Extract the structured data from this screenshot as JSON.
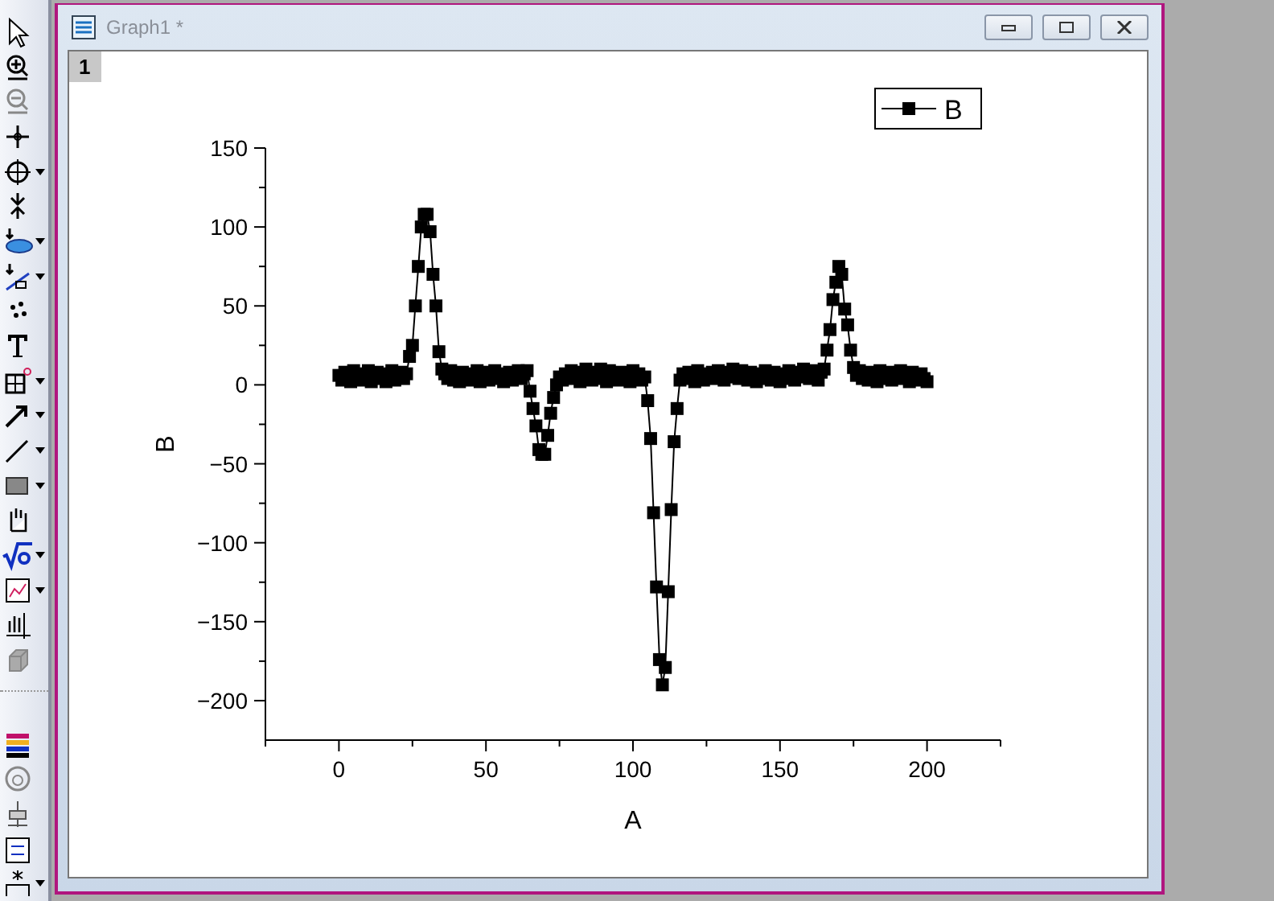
{
  "window": {
    "title": "Graph1 *",
    "layer": "1"
  },
  "graph": {
    "chart_data": {
      "type": "line",
      "xlabel": "A",
      "ylabel": "B",
      "xlim": [
        -25,
        225
      ],
      "ylim": [
        -225,
        150
      ],
      "xticks": [
        0,
        50,
        100,
        150,
        200
      ],
      "yticks": [
        -200,
        -150,
        -100,
        -50,
        0,
        50,
        100,
        150
      ],
      "x": [
        0,
        1,
        2,
        3,
        4,
        5,
        6,
        7,
        8,
        9,
        10,
        11,
        12,
        13,
        14,
        15,
        16,
        17,
        18,
        19,
        20,
        21,
        22,
        23,
        24,
        25,
        26,
        27,
        28,
        29,
        30,
        31,
        32,
        33,
        34,
        35,
        36,
        37,
        38,
        39,
        40,
        41,
        42,
        43,
        44,
        45,
        46,
        47,
        48,
        49,
        50,
        51,
        52,
        53,
        54,
        55,
        56,
        57,
        58,
        59,
        60,
        61,
        62,
        63,
        64,
        65,
        66,
        67,
        68,
        69,
        70,
        71,
        72,
        73,
        74,
        75,
        76,
        77,
        78,
        79,
        80,
        81,
        82,
        83,
        84,
        85,
        86,
        87,
        88,
        89,
        90,
        91,
        92,
        93,
        94,
        95,
        96,
        97,
        98,
        99,
        100,
        101,
        102,
        103,
        104,
        105,
        106,
        107,
        108,
        109,
        110,
        111,
        112,
        113,
        114,
        115,
        116,
        117,
        118,
        119,
        120,
        121,
        122,
        123,
        124,
        125,
        126,
        127,
        128,
        129,
        130,
        131,
        132,
        133,
        134,
        135,
        136,
        137,
        138,
        139,
        140,
        141,
        142,
        143,
        144,
        145,
        146,
        147,
        148,
        149,
        150,
        151,
        152,
        153,
        154,
        155,
        156,
        157,
        158,
        159,
        160,
        161,
        162,
        163,
        164,
        165,
        166,
        167,
        168,
        169,
        170,
        171,
        172,
        173,
        174,
        175,
        176,
        177,
        178,
        179,
        180,
        181,
        182,
        183,
        184,
        185,
        186,
        187,
        188,
        189,
        190,
        191,
        192,
        193,
        194,
        195,
        196,
        197,
        198,
        199,
        200
      ],
      "series": [
        {
          "name": "B",
          "color": "#000000",
          "marker": "square",
          "values": [
            6,
            3,
            8,
            5,
            2,
            9,
            4,
            7,
            3,
            6,
            9,
            2,
            5,
            8,
            4,
            7,
            2,
            6,
            9,
            3,
            5,
            8,
            4,
            7,
            18,
            25,
            50,
            75,
            100,
            108,
            108,
            97,
            70,
            50,
            21,
            10,
            7,
            4,
            9,
            3,
            6,
            2,
            8,
            5,
            3,
            7,
            4,
            9,
            2,
            6,
            8,
            3,
            5,
            9,
            4,
            7,
            2,
            6,
            8,
            3,
            5,
            9,
            4,
            7,
            9,
            -4,
            -15,
            -26,
            -41,
            -44,
            -44,
            -32,
            -18,
            -8,
            0,
            5,
            3,
            7,
            5,
            9,
            4,
            8,
            2,
            6,
            10,
            5,
            3,
            8,
            4,
            10,
            6,
            2,
            9,
            5,
            7,
            3,
            8,
            4,
            6,
            2,
            9,
            5,
            7,
            3,
            5,
            -10,
            -34,
            -81,
            -128,
            -174,
            -190,
            -179,
            -131,
            -79,
            -36,
            -15,
            3,
            7,
            4,
            8,
            5,
            2,
            9,
            6,
            3,
            7,
            5,
            8,
            4,
            9,
            6,
            3,
            8,
            5,
            10,
            7,
            4,
            9,
            6,
            3,
            8,
            5,
            2,
            7,
            4,
            9,
            6,
            3,
            8,
            5,
            2,
            7,
            4,
            9,
            6,
            3,
            8,
            5,
            10,
            7,
            4,
            9,
            6,
            3,
            8,
            10,
            22,
            35,
            54,
            65,
            75,
            70,
            48,
            38,
            22,
            11,
            6,
            9,
            4,
            7,
            3,
            8,
            5,
            2,
            9,
            6,
            4,
            8,
            3,
            7,
            5,
            9,
            4,
            6,
            2,
            8,
            5,
            3,
            7,
            4,
            2
          ]
        }
      ]
    }
  }
}
